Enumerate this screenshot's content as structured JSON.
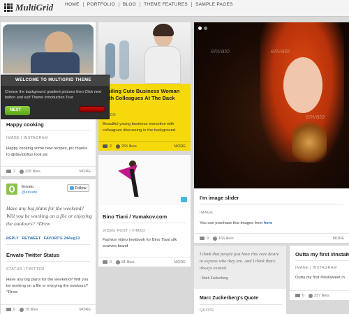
{
  "brand": {
    "name": "MultiGrid"
  },
  "nav": [
    "HOME",
    "PORTFOLIO",
    "BLOG",
    "THEME FEATURES",
    "SAMPLE PAGES"
  ],
  "tour": {
    "title": "WELCOME TO MULTIGRID THEME",
    "body": "Choose the background gradient pictures then Click next button and surf Theme Introduction Tour.",
    "next": "NEXT"
  },
  "card_cooking": {
    "title": "Happy cooking",
    "meta": "IMAGE | INSTAGRAM",
    "text": "Happy cooking some new recipes, pic thanks to @davidofius look pic",
    "comments": "2",
    "likes": "225 likes",
    "more": "MORE"
  },
  "card_twitter": {
    "name": "Envato",
    "handle": "@envato",
    "follow": "Follow",
    "quote": "Have any big plans for the weekend? Will you be working on a file or enjoying the outdoors? ^Drew",
    "actions": "REPLY   RETWEET   FAVORITE 24Aug13",
    "title": "Envato Twitter Status",
    "meta": "STATUS | TWITTER",
    "text": "Have any big plans for the weekend? Will you be working on a file or enjoying the outdoors? ^Drew",
    "comments": "0",
    "likes": "79 likes",
    "more": "MORE"
  },
  "card_business": {
    "title": "Smiling Cute Business Woman With Colleagues At The Back",
    "meta": "IMAGE",
    "text": "Beautiful young business executive with colleagues discussing in the background.",
    "comments": "2",
    "likes": "255 likes",
    "more": "MORE"
  },
  "card_video": {
    "title": "Bino Tiani / Yumakov.com",
    "meta": "VIDEO POST | VIMEO",
    "text": "Fashion video lookbook for Bino Tiani silk scarves brand",
    "comments": "0",
    "likes": "81 likes",
    "more": "MORE"
  },
  "card_slider": {
    "watermark": "envato",
    "title": "I'm image slider",
    "meta": "IMAGE",
    "text": "You can purchase this images from ",
    "link": "here",
    "comments": "9",
    "likes": "166 likes",
    "more": "MORE"
  },
  "card_quote": {
    "quote": "I think that people just have this core desire to express who they are. And I think that's always existed.",
    "author": "- Mark Zuckerberg",
    "title": "Marc Zuckerberg's Quote",
    "meta": "QUOTE"
  },
  "card_insta": {
    "title": "Outta my first #InstaMe",
    "meta": "IMAGE | INSTAGRAM",
    "text": "Outta my first #InstaMeet in",
    "comments": "0",
    "likes": "237 likes"
  },
  "colors": {
    "yellow": "#f5d90b",
    "green": "#7dc42e"
  }
}
